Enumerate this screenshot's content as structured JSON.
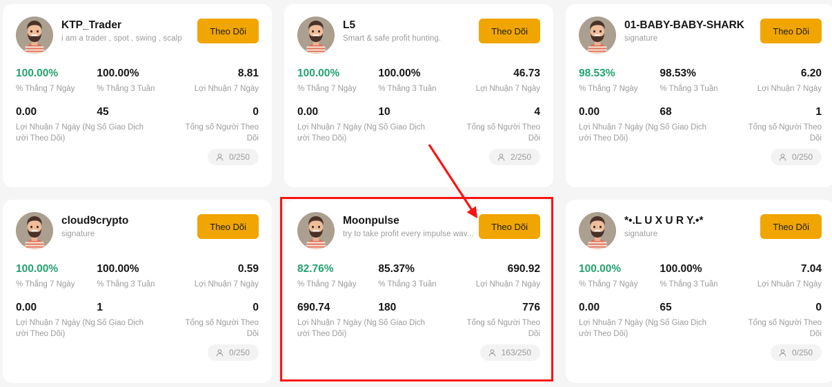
{
  "theme": {
    "page_background": "#f5f5f5",
    "card_background": "#ffffff",
    "follow_button_color": "#f0a500",
    "positive_color": "#23a26d",
    "muted_text_color": "#9b9b9b",
    "highlight_color": "#fb1212"
  },
  "labels": {
    "follow_button": "Theo Dõi",
    "win_rate_7d": "% Thắng 7 Ngày",
    "win_rate_3w": "% Thắng 3 Tuần",
    "profit_7d": "Lợi Nhuận 7 Ngày",
    "profit_7d_followers": "Lợi Nhuận 7 Ngày (Người Theo Dõi)",
    "trades": "Số Giao Dịch",
    "total_followers": "Tổng số Người Theo Dõi"
  },
  "icons": {
    "avatar": "avatar-illustration",
    "follower": "person-icon"
  },
  "cards": [
    {
      "name": "KTP_Trader",
      "description": "i am a trader , spot , swing , scalp",
      "win_rate_7d": "100.00%",
      "win_rate_3w": "100.00%",
      "profit_7d": "8.81",
      "profit_7d_followers": "0.00",
      "trades": "45",
      "total_followers": "0",
      "slots": "0/250",
      "highlighted": false
    },
    {
      "name": "L5",
      "description": "Smart & safe profit hunting.",
      "win_rate_7d": "100.00%",
      "win_rate_3w": "100.00%",
      "profit_7d": "46.73",
      "profit_7d_followers": "0.00",
      "trades": "10",
      "total_followers": "4",
      "slots": "2/250",
      "highlighted": false
    },
    {
      "name": "01-BABY-BABY-SHARK",
      "description": "signature",
      "win_rate_7d": "98.53%",
      "win_rate_3w": "98.53%",
      "profit_7d": "6.20",
      "profit_7d_followers": "0.00",
      "trades": "68",
      "total_followers": "1",
      "slots": "0/250",
      "highlighted": false
    },
    {
      "name": "cloud9crypto",
      "description": "signature",
      "win_rate_7d": "100.00%",
      "win_rate_3w": "100.00%",
      "profit_7d": "0.59",
      "profit_7d_followers": "0.00",
      "trades": "1",
      "total_followers": "0",
      "slots": "0/250",
      "highlighted": false
    },
    {
      "name": "Moonpulse",
      "description": "try to take profit every impulse wav...",
      "win_rate_7d": "82.76%",
      "win_rate_3w": "85.37%",
      "profit_7d": "690.92",
      "profit_7d_followers": "690.74",
      "trades": "180",
      "total_followers": "776",
      "slots": "163/250",
      "highlighted": true
    },
    {
      "name": "*•.L U X U R Y.•*",
      "description": "signature",
      "win_rate_7d": "100.00%",
      "win_rate_3w": "100.00%",
      "profit_7d": "7.04",
      "profit_7d_followers": "0.00",
      "trades": "65",
      "total_followers": "0",
      "slots": "0/250",
      "highlighted": false
    }
  ],
  "annotation": {
    "type": "red-arrow",
    "points_to": "Moonpulse follow button"
  }
}
